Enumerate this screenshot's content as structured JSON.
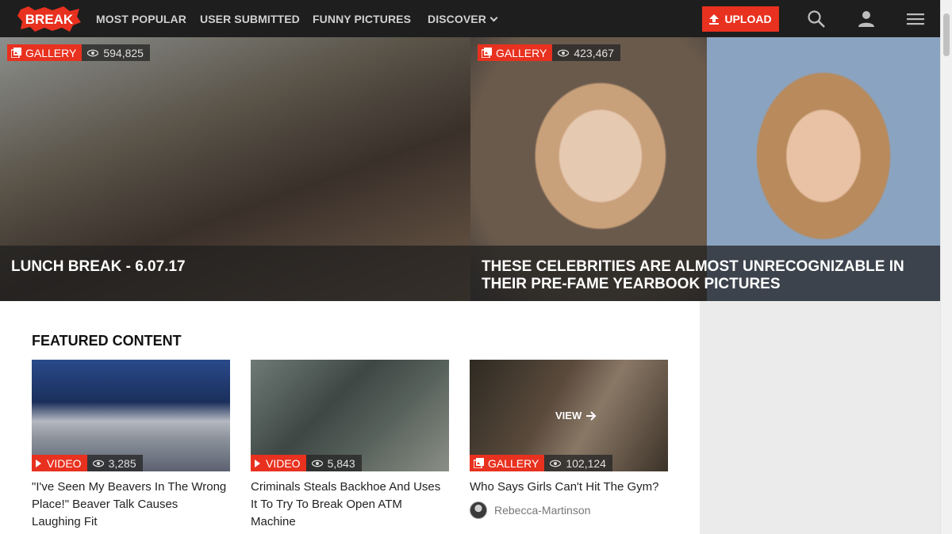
{
  "nav": {
    "logo_text": "BREAK",
    "links": [
      "MOST POPULAR",
      "USER SUBMITTED",
      "FUNNY PICTURES",
      "DISCOVER"
    ],
    "upload_label": "UPLOAD",
    "icons": [
      "search-icon",
      "user-icon",
      "menu-icon"
    ]
  },
  "hero": [
    {
      "badge": "GALLERY",
      "views": "594,825",
      "title": "LUNCH BREAK - 6.07.17"
    },
    {
      "badge": "GALLERY",
      "views": "423,467",
      "title": "THESE CELEBRITIES ARE ALMOST UNRECOGNIZABLE IN THEIR PRE-FAME YEARBOOK PICTURES"
    }
  ],
  "featured": {
    "heading": "FEATURED CONTENT",
    "cards": [
      {
        "type": "VIDEO",
        "views": "3,285",
        "title": "\"I've Seen My Beavers In The Wrong Place!\" Beaver Talk Causes Laughing Fit"
      },
      {
        "type": "VIDEO",
        "views": "5,843",
        "title": "Criminals Steals Backhoe And Uses It To Try To Break Open ATM Machine"
      },
      {
        "type": "GALLERY",
        "views": "102,124",
        "title": "Who Says Girls Can't Hit The Gym?",
        "overlay": "VIEW",
        "author": "Rebecca-Martinson"
      }
    ]
  },
  "colors": {
    "accent": "#e8311f",
    "nav_bg": "#1e1e1e"
  }
}
